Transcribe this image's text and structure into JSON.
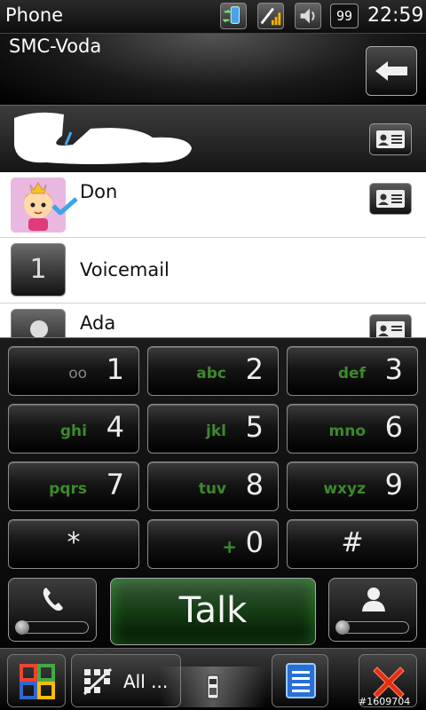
{
  "statusbar": {
    "title": "Phone",
    "battery": "99",
    "time": "22:59",
    "icons": [
      "connectivity-icon",
      "signal-icon",
      "volume-icon",
      "battery-icon"
    ]
  },
  "header": {
    "carrier": "SMC-Voda",
    "back_icon": "backspace-arrow-icon"
  },
  "list": {
    "items": [
      {
        "name": "Don",
        "has_card": true
      },
      {
        "name": "Voicemail",
        "tile": "1"
      },
      {
        "name": "Ada",
        "has_card": true
      }
    ]
  },
  "keypad": {
    "keys": [
      {
        "digit": "1",
        "letters": "oo"
      },
      {
        "digit": "2",
        "letters": "abc"
      },
      {
        "digit": "3",
        "letters": "def"
      },
      {
        "digit": "4",
        "letters": "ghi"
      },
      {
        "digit": "5",
        "letters": "jkl"
      },
      {
        "digit": "6",
        "letters": "mno"
      },
      {
        "digit": "7",
        "letters": "pqrs"
      },
      {
        "digit": "8",
        "letters": "tuv"
      },
      {
        "digit": "9",
        "letters": "wxyz"
      },
      {
        "digit": "*",
        "letters": ""
      },
      {
        "digit": "0",
        "letters": "+"
      },
      {
        "digit": "#",
        "letters": ""
      }
    ],
    "talk_label": "Talk"
  },
  "taskbar": {
    "filter_label": "All ..."
  },
  "watermark": "#1609704",
  "colors": {
    "accent_green": "#3b8a2c",
    "talk_green": "#143d14",
    "close_red": "#e03010"
  }
}
